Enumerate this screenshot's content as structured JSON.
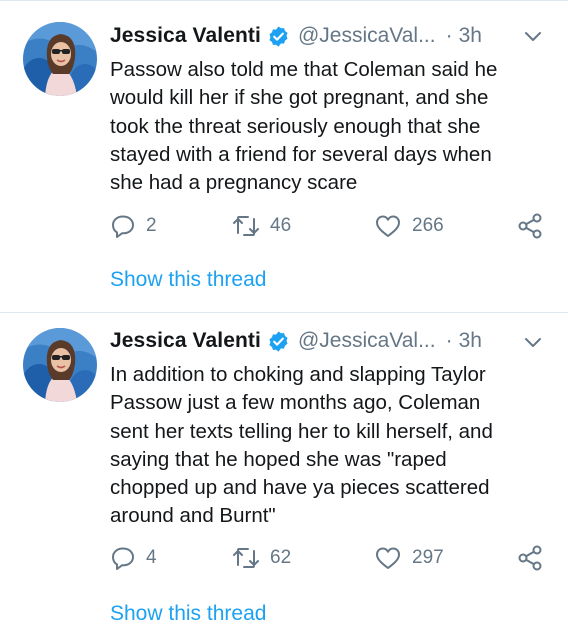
{
  "colors": {
    "link": "#1da1f2",
    "secondary_text": "#657786",
    "primary_text": "#14171a",
    "verified_badge": "#1da1f2",
    "divider": "#e1e8ed"
  },
  "tweets": [
    {
      "author_name": "Jessica Valenti",
      "handle": "@JessicaVal...",
      "separator": "·",
      "time": "3h",
      "verified": true,
      "text": "Passow also told me that Coleman said he\nwould kill her if she got pregnant, and she\ntook the threat seriously enough that she\nstayed with a friend for several days when\nshe had a pregnancy scare",
      "replies": "2",
      "retweets": "46",
      "likes": "266",
      "show_thread": "Show this thread",
      "icons": {
        "reply": "reply-icon",
        "retweet": "retweet-icon",
        "like": "heart-icon",
        "share": "share-icon",
        "menu": "chevron-down-icon"
      }
    },
    {
      "author_name": "Jessica Valenti",
      "handle": "@JessicaVal...",
      "separator": "·",
      "time": "3h",
      "verified": true,
      "text": "In addition to choking and slapping Taylor\nPassow just a few months ago, Coleman\nsent her texts telling her to kill herself, and\nsaying that he hoped she was \"raped\nchopped up and have ya pieces scattered\naround and Burnt\"",
      "replies": "4",
      "retweets": "62",
      "likes": "297",
      "show_thread": "Show this thread",
      "icons": {
        "reply": "reply-icon",
        "retweet": "retweet-icon",
        "like": "heart-icon",
        "share": "share-icon",
        "menu": "chevron-down-icon"
      }
    }
  ]
}
